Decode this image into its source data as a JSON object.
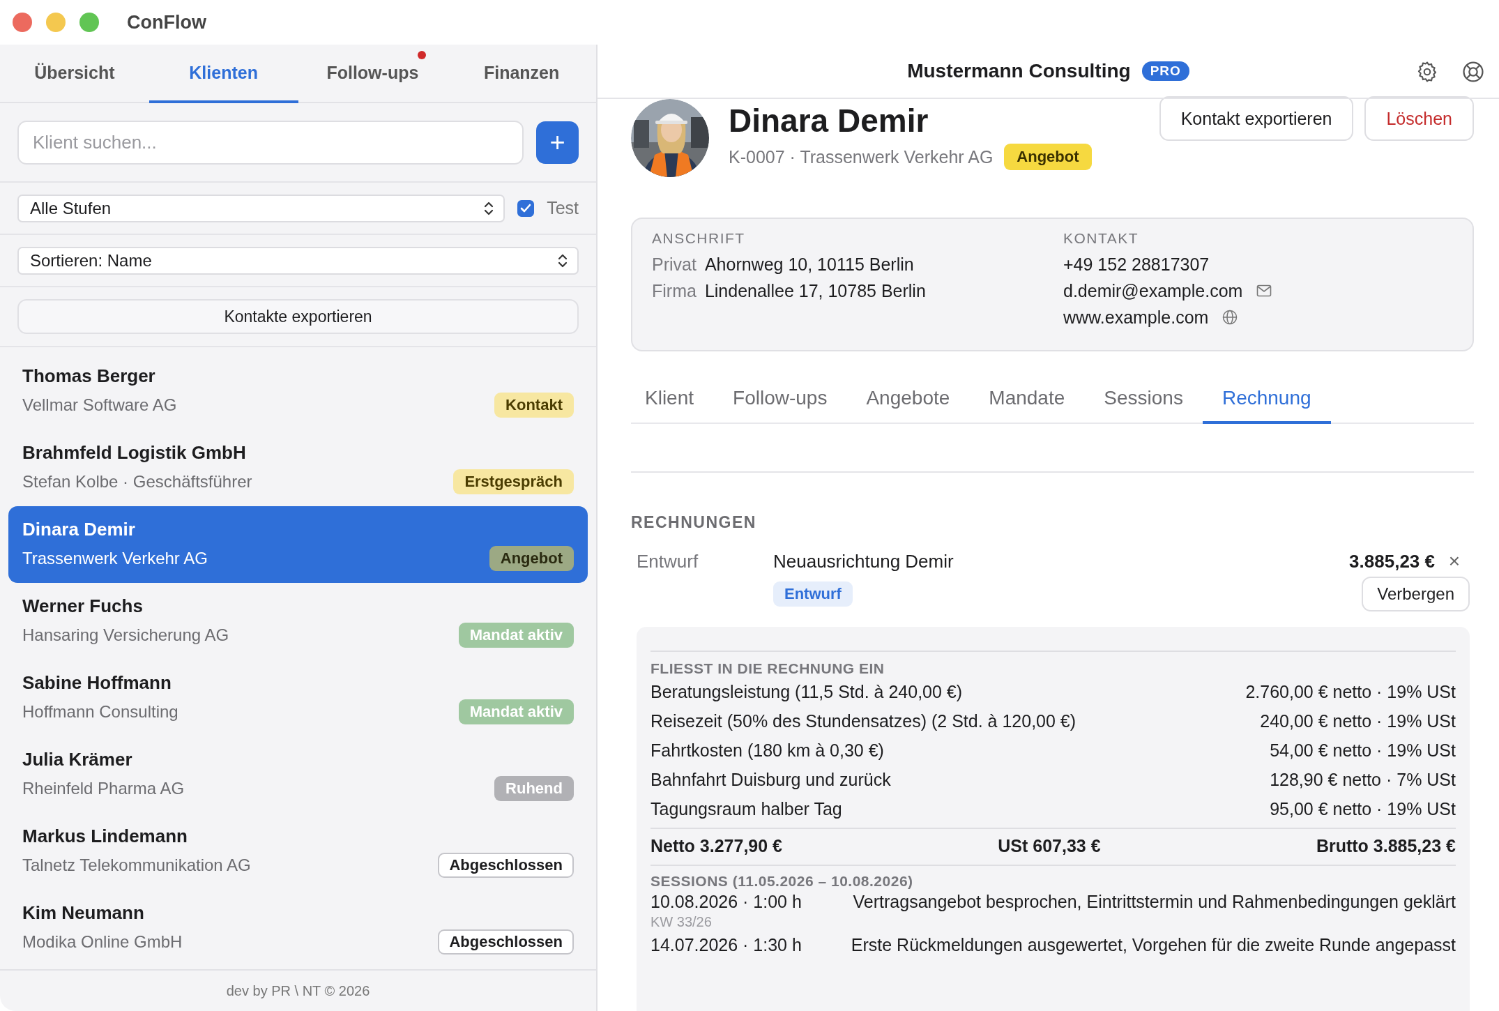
{
  "window": {
    "title": "ConFlow"
  },
  "nav_tabs": [
    {
      "label": "Übersicht",
      "selected": false,
      "notification": false
    },
    {
      "label": "Klienten",
      "selected": true,
      "notification": false
    },
    {
      "label": "Follow-ups",
      "selected": false,
      "notification": true
    },
    {
      "label": "Finanzen",
      "selected": false,
      "notification": false
    }
  ],
  "search": {
    "placeholder": "Klient suchen..."
  },
  "add_button": {
    "label": "+"
  },
  "stage_filter": {
    "value": "Alle Stufen"
  },
  "test_toggle": {
    "label": "Test",
    "checked": true
  },
  "sort": {
    "value": "Sortieren: Name"
  },
  "export_button": {
    "label": "Kontakte exportieren"
  },
  "clients": [
    {
      "name": "Thomas Berger",
      "subtitle": "Vellmar Software AG",
      "stage": {
        "label": "Kontakt",
        "kind": "contact"
      },
      "selected": false
    },
    {
      "name": "Brahmfeld Logistik GmbH",
      "subtitle": "Stefan Kolbe · Geschäftsführer",
      "stage": {
        "label": "Erstgespräch",
        "kind": "contact"
      },
      "selected": false
    },
    {
      "name": "Dinara Demir",
      "subtitle": "Trassenwerk Verkehr AG",
      "stage": {
        "label": "Angebot",
        "kind": "offer"
      },
      "selected": true
    },
    {
      "name": "Werner Fuchs",
      "subtitle": "Hansaring Versicherung AG",
      "stage": {
        "label": "Mandat aktiv",
        "kind": "active"
      },
      "selected": false
    },
    {
      "name": "Sabine Hoffmann",
      "subtitle": "Hoffmann Consulting",
      "stage": {
        "label": "Mandat aktiv",
        "kind": "active"
      },
      "selected": false
    },
    {
      "name": "Julia Krämer",
      "subtitle": "Rheinfeld Pharma AG",
      "stage": {
        "label": "Ruhend",
        "kind": "dormant"
      },
      "selected": false
    },
    {
      "name": "Markus Lindemann",
      "subtitle": "Talnetz Telekommunikation AG",
      "stage": {
        "label": "Abgeschlossen",
        "kind": "closed"
      },
      "selected": false
    },
    {
      "name": "Kim Neumann",
      "subtitle": "Modika Online GmbH",
      "stage": {
        "label": "Abgeschlossen",
        "kind": "closed"
      },
      "selected": false
    }
  ],
  "footer": "dev by PR \\ NT © 2026",
  "company": {
    "name": "Mustermann Consulting",
    "plan": "PRO"
  },
  "client": {
    "name": "Dinara Demir",
    "meta": "K-0007 · Trassenwerk Verkehr AG",
    "stage": {
      "label": "Angebot",
      "kind": "offer"
    }
  },
  "actions": [
    {
      "label": "Kontakt exportieren",
      "kind": "default"
    },
    {
      "label": "Löschen",
      "kind": "danger"
    }
  ],
  "address": {
    "heading": "ANSCHRIFT",
    "rows": [
      {
        "label": "Privat",
        "value": "Ahornweg 10, 10115 Berlin"
      },
      {
        "label": "Firma",
        "value": "Lindenallee 17, 10785 Berlin"
      }
    ]
  },
  "contact": {
    "heading": "KONTAKT",
    "rows": [
      {
        "value": "+49 152 28817307",
        "kind": "phone"
      },
      {
        "value": "d.demir@example.com",
        "kind": "email"
      },
      {
        "value": "www.example.com",
        "kind": "web"
      }
    ]
  },
  "detail_tabs": [
    {
      "label": "Klient",
      "selected": false
    },
    {
      "label": "Follow-ups",
      "selected": false
    },
    {
      "label": "Angebote",
      "selected": false
    },
    {
      "label": "Mandate",
      "selected": false
    },
    {
      "label": "Sessions",
      "selected": false
    },
    {
      "label": "Rechnung",
      "selected": true
    }
  ],
  "invoices": {
    "heading": "RECHNUNGEN",
    "items": [
      {
        "status": "Entwurf",
        "title": "Neuausrichtung Demir",
        "amount": "3.885,23 €",
        "remove": "×",
        "badge": "Entwurf",
        "toggle_button": "Verbergen",
        "breakdown": {
          "heading": "FLIESST IN DIE RECHNUNG EIN",
          "lines": [
            {
              "description": "Beratungsleistung (11,5 Std. à 240,00 €)",
              "amount": "2.760,00 € netto · 19% USt"
            },
            {
              "description": "Reisezeit (50% des Stundensatzes) (2 Std. à 120,00 €)",
              "amount": "240,00 € netto · 19% USt"
            },
            {
              "description": "Fahrtkosten (180 km à 0,30 €)",
              "amount": "54,00 € netto · 19% USt"
            },
            {
              "description": "Bahnfahrt Duisburg und zurück",
              "amount": "128,90 € netto · 7% USt"
            },
            {
              "description": "Tagungsraum halber Tag",
              "amount": "95,00 € netto · 19% USt"
            }
          ],
          "totals": [
            "Netto 3.277,90 €",
            "USt 607,33 €",
            "Brutto 3.885,23 €"
          ],
          "sessions_heading": "SESSIONS (11.05.2026 – 10.08.2026)",
          "sessions": [
            {
              "when": "10.08.2026 · 1:00 h",
              "note": "Vertragsangebot besprochen, Eintrittstermin und Rahmenbedingungen geklärt",
              "week": "KW 33/26"
            },
            {
              "when": "14.07.2026 · 1:30 h",
              "note": "Erste Rückmeldungen ausgewertet, Vorgehen für die zweite Runde angepasst"
            }
          ]
        }
      }
    ]
  }
}
